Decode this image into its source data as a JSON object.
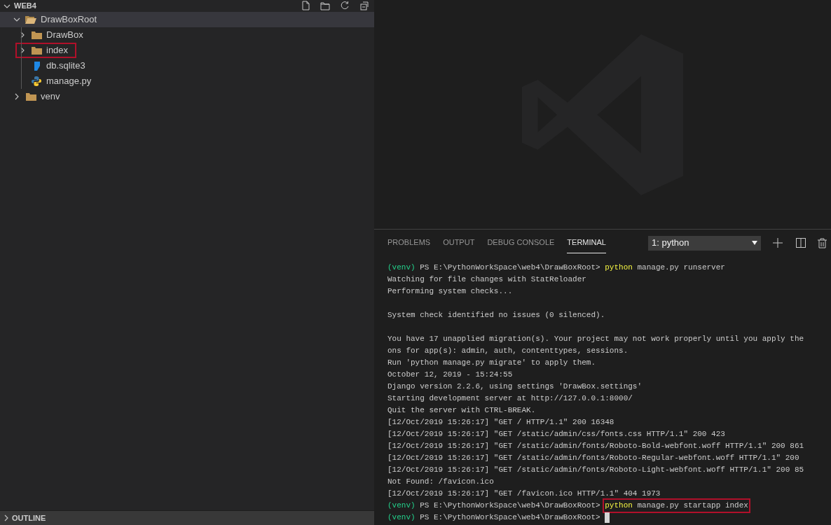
{
  "explorer": {
    "title": "WEB4",
    "expanded": true,
    "tree": [
      {
        "label": "DrawBoxRoot",
        "kind": "folder",
        "expanded": true,
        "selected": true,
        "highlighted": false,
        "children": [
          {
            "label": "DrawBox",
            "kind": "folder",
            "expanded": false,
            "selected": false,
            "highlighted": false
          },
          {
            "label": "index",
            "kind": "folder",
            "expanded": false,
            "selected": false,
            "highlighted": true
          },
          {
            "label": "db.sqlite3",
            "kind": "database",
            "selected": false,
            "highlighted": false
          },
          {
            "label": "manage.py",
            "kind": "python",
            "selected": false,
            "highlighted": false
          }
        ]
      },
      {
        "label": "venv",
        "kind": "folder",
        "expanded": false,
        "selected": false,
        "highlighted": false
      }
    ]
  },
  "outline": {
    "title": "OUTLINE",
    "expanded": false
  },
  "panel": {
    "tabs": [
      {
        "label": "PROBLEMS",
        "selected": false
      },
      {
        "label": "OUTPUT",
        "selected": false
      },
      {
        "label": "DEBUG CONSOLE",
        "selected": false
      },
      {
        "label": "TERMINAL",
        "selected": true
      }
    ],
    "terminal_select": "1: python",
    "lines": [
      {
        "kind": "prompt",
        "env": "(venv)",
        "path": " PS E:\\PythonWorkSpace\\web4\\DrawBoxRoot> ",
        "program": "python",
        "args": " manage.py runserver",
        "highlighted": false,
        "cursor": false
      },
      {
        "kind": "text",
        "text": "Watching for file changes with StatReloader"
      },
      {
        "kind": "text",
        "text": "Performing system checks..."
      },
      {
        "kind": "blank"
      },
      {
        "kind": "text",
        "text": "System check identified no issues (0 silenced)."
      },
      {
        "kind": "blank"
      },
      {
        "kind": "text",
        "text": "You have 17 unapplied migration(s). Your project may not work properly until you apply the"
      },
      {
        "kind": "text",
        "text": "ons for app(s): admin, auth, contenttypes, sessions."
      },
      {
        "kind": "text",
        "text": "Run 'python manage.py migrate' to apply them."
      },
      {
        "kind": "text",
        "text": "October 12, 2019 - 15:24:55"
      },
      {
        "kind": "text",
        "text": "Django version 2.2.6, using settings 'DrawBox.settings'"
      },
      {
        "kind": "text",
        "text": "Starting development server at http://127.0.0.1:8000/"
      },
      {
        "kind": "text",
        "text": "Quit the server with CTRL-BREAK."
      },
      {
        "kind": "text",
        "text": "[12/Oct/2019 15:26:17] \"GET / HTTP/1.1\" 200 16348"
      },
      {
        "kind": "text",
        "text": "[12/Oct/2019 15:26:17] \"GET /static/admin/css/fonts.css HTTP/1.1\" 200 423"
      },
      {
        "kind": "text",
        "text": "[12/Oct/2019 15:26:17] \"GET /static/admin/fonts/Roboto-Bold-webfont.woff HTTP/1.1\" 200 861"
      },
      {
        "kind": "text",
        "text": "[12/Oct/2019 15:26:17] \"GET /static/admin/fonts/Roboto-Regular-webfont.woff HTTP/1.1\" 200"
      },
      {
        "kind": "text",
        "text": "[12/Oct/2019 15:26:17] \"GET /static/admin/fonts/Roboto-Light-webfont.woff HTTP/1.1\" 200 85"
      },
      {
        "kind": "text",
        "text": "Not Found: /favicon.ico"
      },
      {
        "kind": "text",
        "text": "[12/Oct/2019 15:26:17] \"GET /favicon.ico HTTP/1.1\" 404 1973"
      },
      {
        "kind": "prompt",
        "env": "(venv)",
        "path": " PS E:\\PythonWorkSpace\\web4\\DrawBoxRoot> ",
        "program": "python",
        "args": " manage.py startapp index",
        "highlighted": true,
        "cursor": false
      },
      {
        "kind": "prompt",
        "env": "(venv)",
        "path": " PS E:\\PythonWorkSpace\\web4\\DrawBoxRoot>",
        "highlighted": false,
        "cursor": true
      }
    ]
  }
}
